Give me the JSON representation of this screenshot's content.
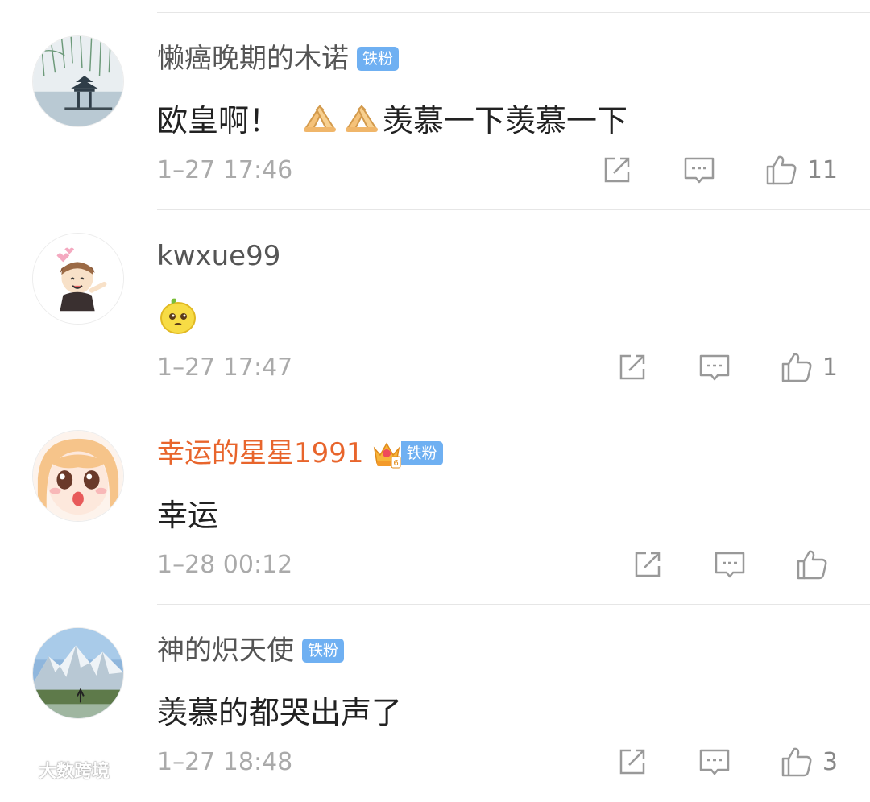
{
  "comments": [
    {
      "username": "懒癌晚期的木诺",
      "badge": "铁粉",
      "text": "欧皇啊！",
      "text_after_emoji": "羡慕一下羡慕一下",
      "emoji": [
        "pray-hands-emoji",
        "pray-hands-emoji"
      ],
      "timestamp": "1–27 17:46",
      "likes": "11",
      "avatar": "pavilion-landscape"
    },
    {
      "username": "kwxue99",
      "badge": "",
      "text": "",
      "emoji": [
        "lemon-emoji"
      ],
      "timestamp": "1–27 17:47",
      "likes": "1",
      "avatar": "cartoon-boy"
    },
    {
      "username": "幸运的星星1991",
      "badge": "铁粉",
      "crown_level": "6",
      "text": "幸运",
      "timestamp": "1–28 00:12",
      "likes": "",
      "avatar": "anime-girl"
    },
    {
      "username": "神的炽天使",
      "badge": "铁粉",
      "text": "羡慕的都哭出声了",
      "timestamp": "1–27 18:48",
      "likes": "3",
      "avatar": "snow-mountain"
    }
  ],
  "icons": {
    "repost": "repost-icon",
    "comment": "comment-icon",
    "like": "thumbs-up-icon"
  },
  "colors": {
    "badge": "#6fb0f2",
    "vip_name": "#e8652c",
    "timestamp": "#aaaaaa"
  },
  "watermark": "大数跨境"
}
